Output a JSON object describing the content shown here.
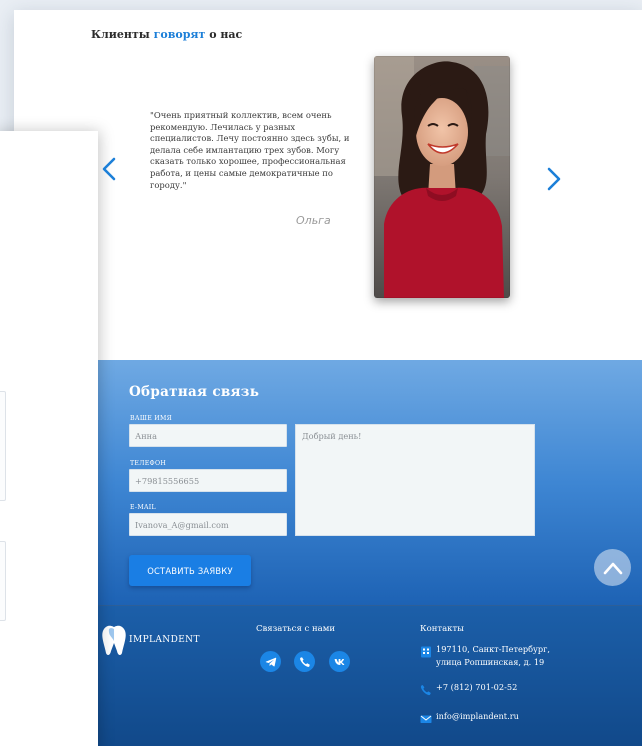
{
  "testimonials": {
    "title_part1": "Клиенты ",
    "title_accent": "говорят",
    "title_part2": " о нас",
    "quote": "\"Очень приятный коллектив, всем очень рекомендую. Лечилась у разных специалистов. Лечу постоянно здесь зубы, и делала себе имлантацию трех зубов. Могу сказать только хорошее, профессиональная работа, и цены самые демократичные по городу.\"",
    "author": "Ольга"
  },
  "feedback": {
    "title": "Обратная связь",
    "name_label": "ВАШЕ ИМЯ",
    "name_value": "Анна",
    "phone_label": "ТЕЛЕФОН",
    "phone_value": "+79815556655",
    "email_label": "E-MAIL",
    "email_value": "Ivanova_A@gmail.com",
    "message_value": "Добрый день!",
    "submit_label": "ОСТАВИТЬ ЗАЯВКУ"
  },
  "footer": {
    "brand": "IMPLANDENT",
    "contact_us_heading": "Связаться с нами",
    "contacts_heading": "Контакты",
    "address_line1": "197110, Санкт-Петербург,",
    "address_line2": "улица Ропшинская, д. 19",
    "phone": "+7 (812) 701-02-52",
    "email": "info@implandent.ru"
  },
  "icons": {
    "prev": "chevron-left-icon",
    "next": "chevron-right-icon",
    "scroll_top": "chevron-up-icon",
    "telegram": "telegram-icon",
    "phone_social": "phone-icon",
    "vk": "vk-icon",
    "address": "map-grid-icon",
    "phone_contact": "phone-icon",
    "email": "envelope-icon"
  },
  "colors": {
    "accent": "#1c7fd8",
    "button": "#1a7ee4",
    "footer": "#11498a"
  }
}
